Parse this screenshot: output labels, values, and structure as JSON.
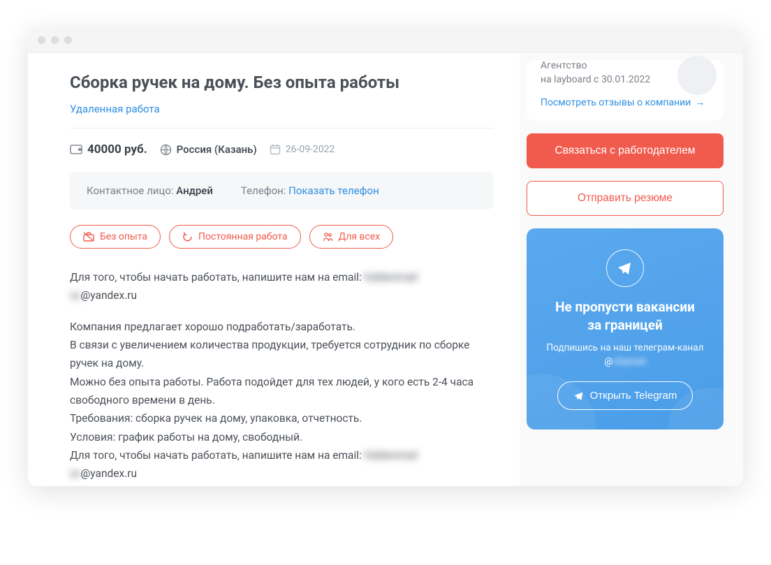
{
  "header": {
    "title": "Сборка ручек на дому. Без опыта работы",
    "remote_label": "Удаленная работа",
    "salary": "40000 руб.",
    "location": "Россия (Казань)",
    "date": "26-09-2022"
  },
  "contact": {
    "person_label": "Контактное лицо:",
    "person_value": "Андрей",
    "phone_label": "Телефон:",
    "show_phone": "Показать телефон"
  },
  "chips": {
    "experience": "Без опыта",
    "employment": "Постоянная работа",
    "audience": "Для всех"
  },
  "description": {
    "intro_prefix": "Для того, чтобы начать работать, напишите нам на email: ",
    "intro_suffix": "@yandex.ru",
    "email_hidden": "hiddenmail",
    "body_lines": [
      "Компания предлагает хорошо подработать/заработать.",
      "В связи с увеличением количества продукции, требуется сотрудник по сборке ручек на дому.",
      "Можно без опыта работы. Работа подойдет для тех людей, у кого есть 2-4 часа свободного времени в день.",
      "Требования: сборка ручек на дому, упаковка, отчетность.",
      "Условия: график работы на дому, свободный.",
      "Для того, чтобы начать работать, напишите нам на email: "
    ],
    "outro_hidden": "hiddenmail",
    "outro_suffix": "@yandex.ru"
  },
  "sidebar": {
    "company_type": "Агентство",
    "company_since": "на layboard с 30.01.2022",
    "reviews_link": "Посмотреть отзывы о компании",
    "contact_button": "Связаться с работодателем",
    "resume_button": "Отправить резюме",
    "tg": {
      "title_line1": "Не пропусти вакансии",
      "title_line2": "за границей",
      "subtitle": "Подпишись на наш телеграм-канал",
      "handle_prefix": "@",
      "handle_hidden": "channel",
      "open_btn": "Открыть Telegram"
    }
  }
}
